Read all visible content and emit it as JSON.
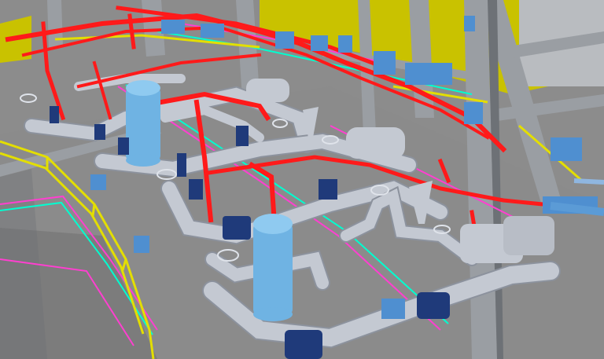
{
  "scene": {
    "palette": {
      "floor": "#8b8b8b",
      "floor_dark": "#6e6e6e",
      "steel": "#9a9ea3",
      "steel_dark": "#6d7176",
      "yellow_wall": "#c9c200",
      "pipe_gray": "#c4c9d2",
      "pipe_gray_dark": "#8c929d",
      "pipe_red": "#ff1a1a",
      "vessel_blue": "#6fb3e3",
      "equipment_blue": "#4f8fd0",
      "valve_navy": "#1f3a7a",
      "railing_yellow": "#e3de00",
      "cable_magenta": "#ff3fd0",
      "cable_cyan": "#00ffd0"
    }
  }
}
